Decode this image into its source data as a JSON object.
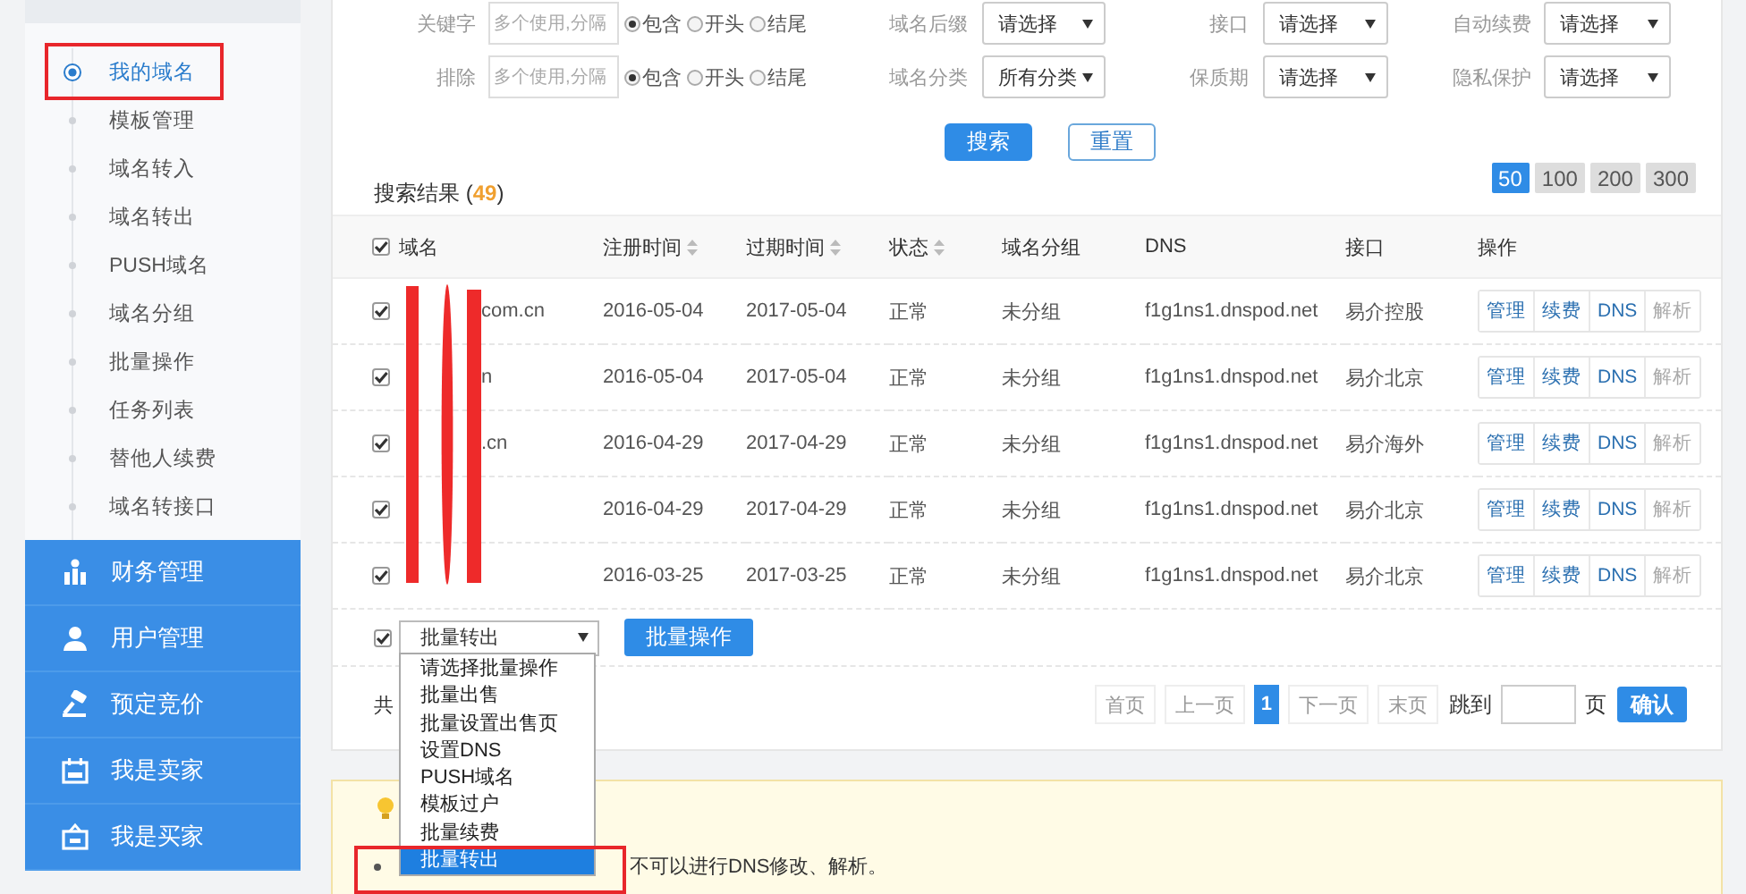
{
  "sidebar": {
    "sub_items": [
      {
        "label": "我的域名",
        "selected": true
      },
      {
        "label": "模板管理",
        "selected": false
      },
      {
        "label": "域名转入",
        "selected": false
      },
      {
        "label": "域名转出",
        "selected": false
      },
      {
        "label": "PUSH域名",
        "selected": false
      },
      {
        "label": "域名分组",
        "selected": false
      },
      {
        "label": "批量操作",
        "selected": false
      },
      {
        "label": "任务列表",
        "selected": false
      },
      {
        "label": "替他人续费",
        "selected": false
      },
      {
        "label": "域名转接口",
        "selected": false
      }
    ],
    "sections": [
      {
        "label": "财务管理",
        "kind": "finance"
      },
      {
        "label": "用户管理",
        "kind": "user"
      },
      {
        "label": "预定竞价",
        "kind": "auction"
      },
      {
        "label": "我是卖家",
        "kind": "seller"
      },
      {
        "label": "我是买家",
        "kind": "buyer"
      }
    ]
  },
  "filters": [
    [
      {
        "kind": "text",
        "label": "关键字",
        "placeholder": "多个使用,分隔",
        "radios": [
          {
            "label": "包含",
            "selected": true
          },
          {
            "label": "开头",
            "selected": false
          },
          {
            "label": "结尾",
            "selected": false
          }
        ]
      },
      {
        "kind": "select",
        "label": "域名后缀",
        "value": "请选择"
      },
      {
        "kind": "select",
        "label": "接口",
        "value": "请选择"
      },
      {
        "kind": "select",
        "label": "自动续费",
        "value": "请选择"
      }
    ],
    [
      {
        "kind": "text",
        "label": "排除",
        "placeholder": "多个使用,分隔",
        "radios": [
          {
            "label": "包含",
            "selected": true
          },
          {
            "label": "开头",
            "selected": false
          },
          {
            "label": "结尾",
            "selected": false
          }
        ]
      },
      {
        "kind": "select",
        "label": "域名分类",
        "value": "所有分类"
      },
      {
        "kind": "select",
        "label": "保质期",
        "value": "请选择"
      },
      {
        "kind": "select",
        "label": "隐私保护",
        "value": "请选择"
      }
    ]
  ],
  "buttons": [
    {
      "label": "搜索",
      "kind": "primary"
    },
    {
      "label": "重置",
      "kind": "outline"
    }
  ],
  "results": {
    "label": "搜索结果 (",
    "count": "49",
    "close": ")"
  },
  "page_sizes": [
    {
      "label": "50",
      "selected": true
    },
    {
      "label": "100",
      "selected": false
    },
    {
      "label": "200",
      "selected": false
    },
    {
      "label": "300",
      "selected": false
    }
  ],
  "table": {
    "header_checked": true,
    "columns": [
      {
        "label": "域名",
        "sortable": false
      },
      {
        "label": "注册时间",
        "sortable": true
      },
      {
        "label": "过期时间",
        "sortable": true
      },
      {
        "label": "状态",
        "sortable": true
      },
      {
        "label": "域名分组",
        "sortable": false
      },
      {
        "label": "DNS",
        "sortable": false
      },
      {
        "label": "接口",
        "sortable": false
      },
      {
        "label": "操作",
        "sortable": false
      }
    ],
    "rows": [
      {
        "checked": true,
        "domain": "com.cn",
        "registered": "2016-05-04",
        "expires": "2017-05-04",
        "status": "正常",
        "group": "未分组",
        "dns": "f1g1ns1.dnspod.net",
        "interface": "易介控股",
        "actions": [
          {
            "label": "管理",
            "disabled": false
          },
          {
            "label": "续费",
            "disabled": false
          },
          {
            "label": "DNS",
            "disabled": false
          },
          {
            "label": "解析",
            "disabled": true
          }
        ]
      },
      {
        "checked": true,
        "domain": "n",
        "registered": "2016-05-04",
        "expires": "2017-05-04",
        "status": "正常",
        "group": "未分组",
        "dns": "f1g1ns1.dnspod.net",
        "interface": "易介北京",
        "actions": [
          {
            "label": "管理",
            "disabled": false
          },
          {
            "label": "续费",
            "disabled": false
          },
          {
            "label": "DNS",
            "disabled": false
          },
          {
            "label": "解析",
            "disabled": true
          }
        ]
      },
      {
        "checked": true,
        "domain": ".cn",
        "registered": "2016-04-29",
        "expires": "2017-04-29",
        "status": "正常",
        "group": "未分组",
        "dns": "f1g1ns1.dnspod.net",
        "interface": "易介海外",
        "actions": [
          {
            "label": "管理",
            "disabled": false
          },
          {
            "label": "续费",
            "disabled": false
          },
          {
            "label": "DNS",
            "disabled": false
          },
          {
            "label": "解析",
            "disabled": true
          }
        ]
      },
      {
        "checked": true,
        "registered": "2016-04-29",
        "expires": "2017-04-29",
        "status": "正常",
        "group": "未分组",
        "dns": "f1g1ns1.dnspod.net",
        "interface": "易介北京",
        "actions": [
          {
            "label": "管理",
            "disabled": false
          },
          {
            "label": "续费",
            "disabled": false
          },
          {
            "label": "DNS",
            "disabled": false
          },
          {
            "label": "解析",
            "disabled": true
          }
        ]
      },
      {
        "checked": true,
        "registered": "2016-03-25",
        "expires": "2017-03-25",
        "status": "正常",
        "group": "未分组",
        "dns": "f1g1ns1.dnspod.net",
        "interface": "易介北京",
        "actions": [
          {
            "label": "管理",
            "disabled": false
          },
          {
            "label": "续费",
            "disabled": false
          },
          {
            "label": "DNS",
            "disabled": false
          },
          {
            "label": "解析",
            "disabled": true
          }
        ]
      }
    ]
  },
  "batch": {
    "checked": true,
    "value": "批量转出",
    "button": "批量操作",
    "options": [
      {
        "label": "请选择批量操作",
        "selected": false
      },
      {
        "label": "批量出售",
        "selected": false
      },
      {
        "label": "批量设置出售页",
        "selected": false
      },
      {
        "label": "设置DNS",
        "selected": false
      },
      {
        "label": "PUSH域名",
        "selected": false
      },
      {
        "label": "模板过户",
        "selected": false
      },
      {
        "label": "批量续费",
        "selected": false
      },
      {
        "label": "批量转出",
        "selected": true
      }
    ]
  },
  "pagination": {
    "total": "共",
    "pages": [
      {
        "label": "首页",
        "kind": "nav"
      },
      {
        "label": "上一页",
        "kind": "nav"
      },
      {
        "label": "1",
        "kind": "current"
      },
      {
        "label": "下一页",
        "kind": "nav"
      },
      {
        "label": "末页",
        "kind": "nav"
      }
    ],
    "jump_label": "跳到",
    "page_unit": "页",
    "confirm": "确认"
  },
  "tip": {
    "text": "不可以进行DNS修改、解析。"
  }
}
